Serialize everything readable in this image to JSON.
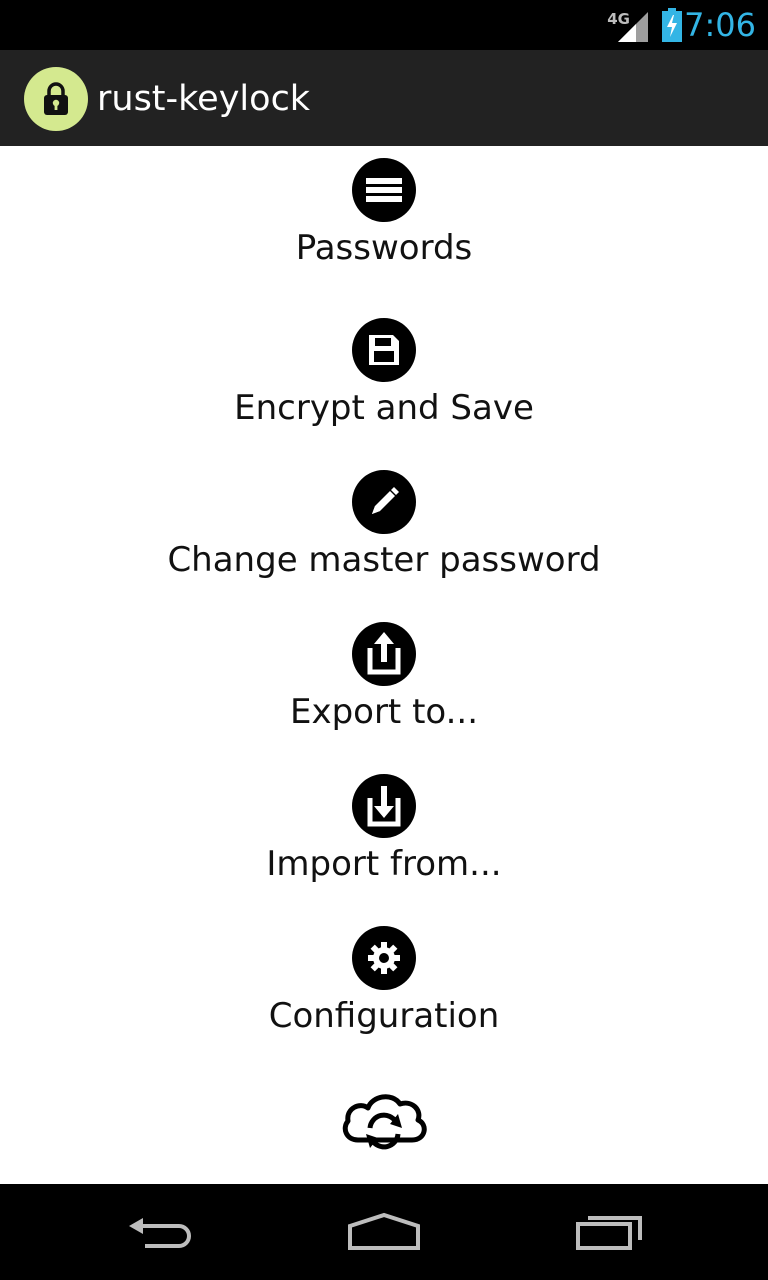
{
  "status_bar": {
    "network": "4G",
    "time": "7:06",
    "signal_icon": "signal-icon",
    "battery_icon": "battery-charging-icon",
    "colors": {
      "time": "#33b5e5"
    }
  },
  "action_bar": {
    "title": "rust-keylock",
    "app_icon": "lock-icon",
    "colors": {
      "background": "#222222",
      "icon_bg": "#d4e98f"
    }
  },
  "menu": {
    "items": [
      {
        "label": "Passwords",
        "icon": "list-icon"
      },
      {
        "label": "Encrypt and Save",
        "icon": "save-icon"
      },
      {
        "label": "Change master password",
        "icon": "pencil-icon"
      },
      {
        "label": "Export to...",
        "icon": "export-icon"
      },
      {
        "label": "Import from...",
        "icon": "import-icon"
      },
      {
        "label": "Configuration",
        "icon": "gear-icon"
      },
      {
        "label": "",
        "icon": "cloud-sync-icon"
      }
    ]
  },
  "nav_bar": {
    "back_icon": "back-icon",
    "home_icon": "home-icon",
    "recents_icon": "recents-icon"
  }
}
